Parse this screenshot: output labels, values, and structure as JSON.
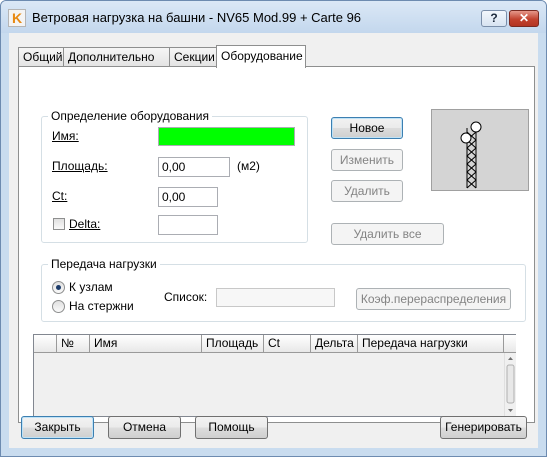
{
  "window": {
    "title": "Ветровая нагрузка на башни - NV65 Mod.99 + Carte 96",
    "help_label": "?",
    "close_label": "✕",
    "app_icon": "k-logo-icon"
  },
  "tabs": [
    {
      "label": "Общий"
    },
    {
      "label": "Дополнительно"
    },
    {
      "label": "Секции"
    },
    {
      "label": "Оборудование",
      "active": true
    }
  ],
  "equipment": {
    "group_title": "Определение оборудования",
    "name_label": "Имя:",
    "name_value": "",
    "name_color": "#00ff00",
    "area_label": "Площадь:",
    "area_value": "0,00",
    "area_unit": "(м2)",
    "ct_label": "Ct:",
    "ct_value": "0,00",
    "delta_label": "Delta:",
    "delta_checked": false,
    "delta_value": ""
  },
  "actions": {
    "new_label": "Новое",
    "edit_label": "Изменить",
    "delete_label": "Удалить",
    "delete_all_label": "Удалить все"
  },
  "transfer": {
    "group_title": "Передача нагрузки",
    "to_nodes_label": "К узлам",
    "to_bars_label": "На стержни",
    "selected": "to_nodes",
    "list_label": "Список:",
    "list_value": "",
    "coef_label": "Коэф.перераспределения"
  },
  "table": {
    "columns": [
      "",
      "№",
      "Имя",
      "Площадь",
      "Ct",
      "Дельта",
      "Передача нагрузки"
    ],
    "rows": []
  },
  "footer": {
    "close_label": "Закрыть",
    "cancel_label": "Отмена",
    "help_label": "Помощь",
    "generate_label": "Генерировать"
  }
}
